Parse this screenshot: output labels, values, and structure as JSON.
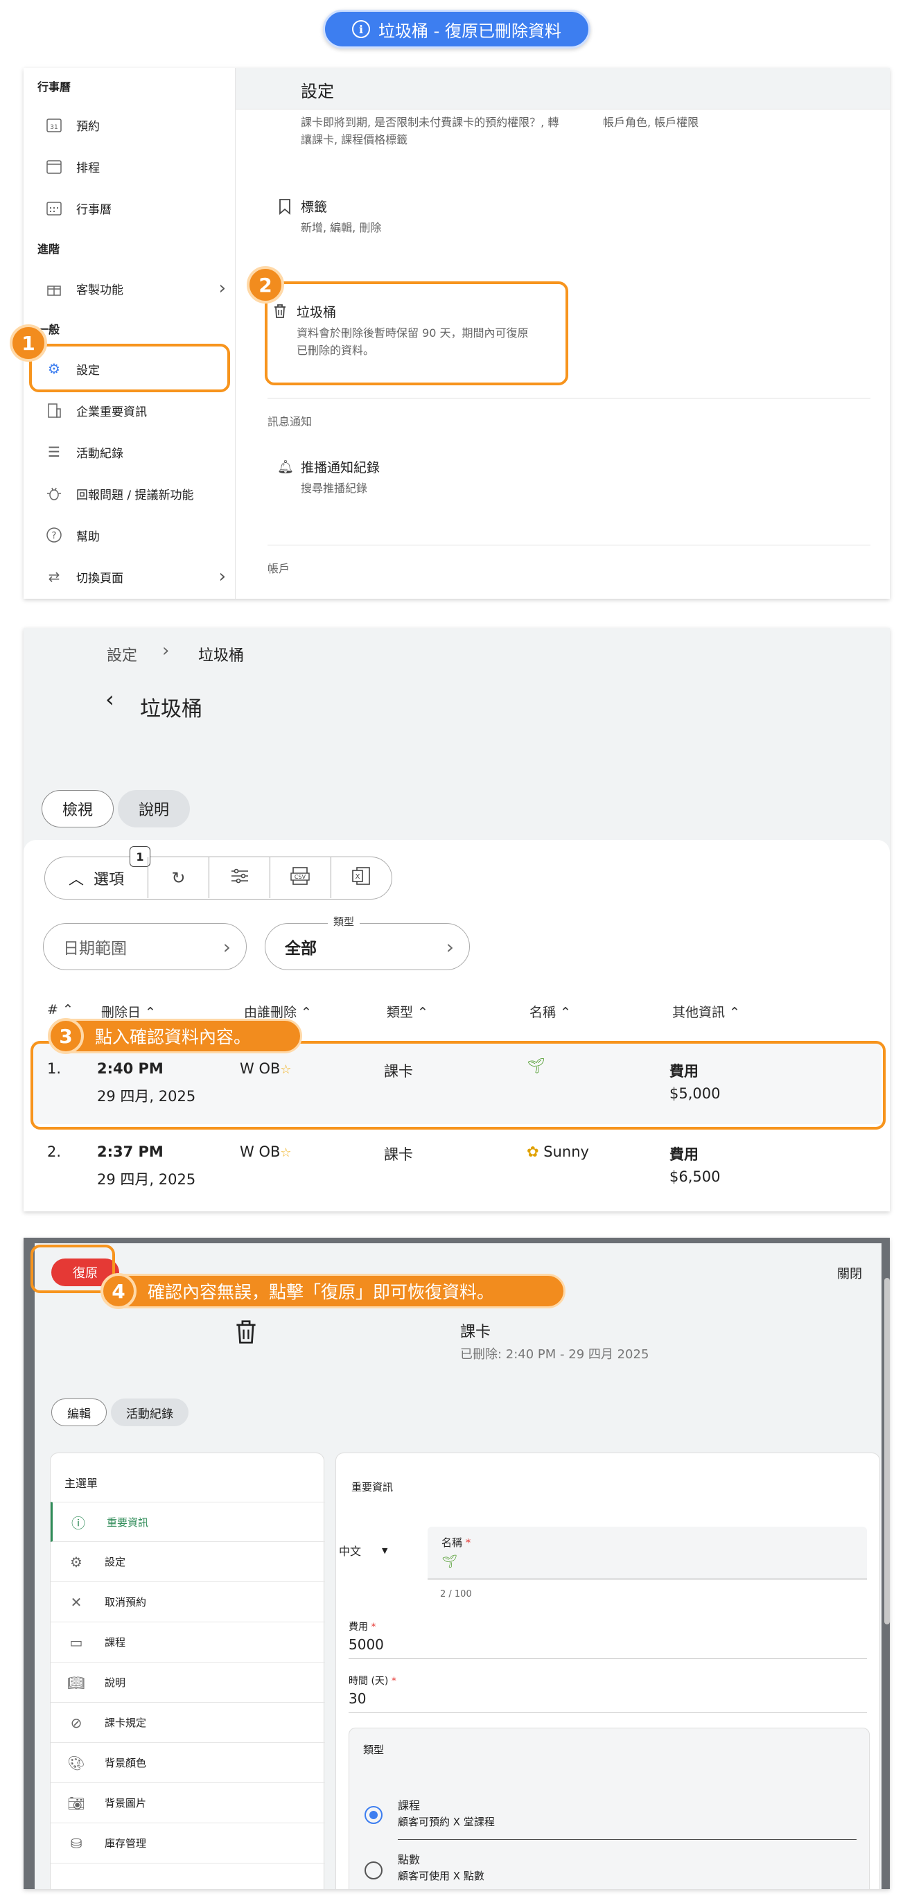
{
  "header": {
    "title": "垃圾桶 - 復原已刪除資料"
  },
  "panel1": {
    "sidebar": {
      "section_calendar": "行事曆",
      "section_advanced": "進階",
      "section_general": "一般",
      "items": [
        {
          "label": "預約",
          "icon": "calendar-31-icon"
        },
        {
          "label": "排程",
          "icon": "calendar-blank-icon"
        },
        {
          "label": "行事曆",
          "icon": "calendar-grid-icon"
        },
        {
          "label": "客製功能",
          "icon": "gift-icon"
        },
        {
          "label": "設定",
          "icon": "gear-icon"
        },
        {
          "label": "企業重要資訊",
          "icon": "building-icon"
        },
        {
          "label": "活動紀錄",
          "icon": "list-icon"
        },
        {
          "label": "回報問題 / 提議新功能",
          "icon": "bug-icon"
        },
        {
          "label": "幫助",
          "icon": "help-icon"
        },
        {
          "label": "切換頁面",
          "icon": "swap-icon"
        }
      ]
    },
    "settings_title": "設定",
    "top_desc_left": "課卡即將到期, 是否限制未付費課卡的預約權限？, 轉讓課卡, 課程價格標籤",
    "top_desc_right": "帳戶角色, 帳戶權限",
    "tags": {
      "title": "標籤",
      "desc": "新增, 編輯, 刪除"
    },
    "trash": {
      "title": "垃圾桶",
      "desc": "資料會於刪除後暫時保留 90 天，期間內可復原已刪除的資料。"
    },
    "section_notify": "訊息通知",
    "push": {
      "title": "推播通知紀錄",
      "desc": "搜尋推播紀錄"
    },
    "section_account": "帳戶",
    "callout_1": "1",
    "callout_2": "2"
  },
  "panel2": {
    "breadcrumb_parent": "設定",
    "breadcrumb_current": "垃圾桶",
    "page_title": "垃圾桶",
    "tab_view": "檢視",
    "tab_desc": "說明",
    "options_label": "選項",
    "options_badge": "1",
    "filter_date": "日期範圍",
    "filter_type_label": "類型",
    "filter_type_value": "全部",
    "columns": [
      "#",
      "刪除日",
      "由誰刪除",
      "類型",
      "名稱",
      "其他資訊"
    ],
    "rows": [
      {
        "num": "1.",
        "time": "2:40 PM",
        "date": "29 四月, 2025",
        "by": "W OB",
        "type": "課卡",
        "name": "",
        "name_icon": "sprout-icon",
        "info_label": "費用",
        "info_value": "$5,000"
      },
      {
        "num": "2.",
        "time": "2:37 PM",
        "date": "29 四月, 2025",
        "by": "W OB",
        "type": "課卡",
        "name": "Sunny",
        "name_icon": "sunflower-icon",
        "info_label": "費用",
        "info_value": "$6,500"
      }
    ],
    "tooltip_num": "3",
    "tooltip_text": "點入確認資料內容。"
  },
  "panel3": {
    "restore": "復原",
    "close": "關閉",
    "tooltip_num": "4",
    "tooltip_text": "確認內容無誤，點擊「復原」即可恢復資料。",
    "record_title": "課卡",
    "record_deleted": "已刪除: 2:40 PM - 29 四月 2025",
    "tab_edit": "編輯",
    "tab_log": "活動紀錄",
    "menu_title": "主選單",
    "menu_items": [
      {
        "label": "重要資訊",
        "icon": "info-icon"
      },
      {
        "label": "設定",
        "icon": "gear-icon"
      },
      {
        "label": "取消預約",
        "icon": "x-icon"
      },
      {
        "label": "課程",
        "icon": "presentation-icon"
      },
      {
        "label": "說明",
        "icon": "book-icon"
      },
      {
        "label": "課卡規定",
        "icon": "ban-icon"
      },
      {
        "label": "背景顏色",
        "icon": "palette-icon"
      },
      {
        "label": "背景圖片",
        "icon": "camera-icon"
      },
      {
        "label": "庫存管理",
        "icon": "database-icon"
      }
    ],
    "form_title": "重要資訊",
    "lang": "中文",
    "name_label": "名稱",
    "name_counter": "2 / 100",
    "fee_label": "費用",
    "fee_value": "5000",
    "time_label": "時間 (天)",
    "time_value": "30",
    "type_label": "類型",
    "opt1_title": "課程",
    "opt1_desc": "顧客可預約 X 堂課程",
    "opt2_title": "點數",
    "opt2_desc": "顧客可使用 X 點數",
    "required_mark": "*",
    "accent": "#3d7ef0",
    "highlight": "#f7941d",
    "restore_color": "#e53935"
  }
}
